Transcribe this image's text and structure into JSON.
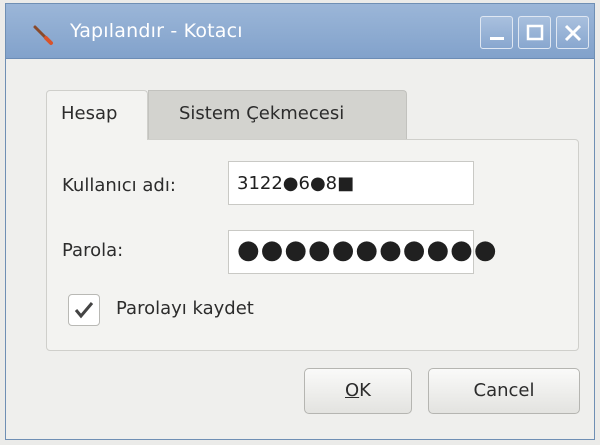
{
  "window": {
    "title": "Yapılandır - Kotacı",
    "icon": "paintbrush-icon",
    "controls": [
      "minimize-icon",
      "maximize-icon",
      "close-icon"
    ]
  },
  "tabs": [
    {
      "label": "Hesap",
      "active": true
    },
    {
      "label": "Sistem Çekmecesi",
      "active": false
    }
  ],
  "form": {
    "username_label": "Kullanıcı adı:",
    "username_value": "3122●6●8■",
    "password_label": "Parola:",
    "password_value": "●●●●●●●●●●●",
    "remember_label": "Parolayı kaydet",
    "remember_checked": true
  },
  "buttons": {
    "ok_mnemonic": "O",
    "ok_rest": "K",
    "cancel": "Cancel"
  },
  "colors": {
    "titlebar": "#8aa9d1",
    "background": "#efefed"
  }
}
